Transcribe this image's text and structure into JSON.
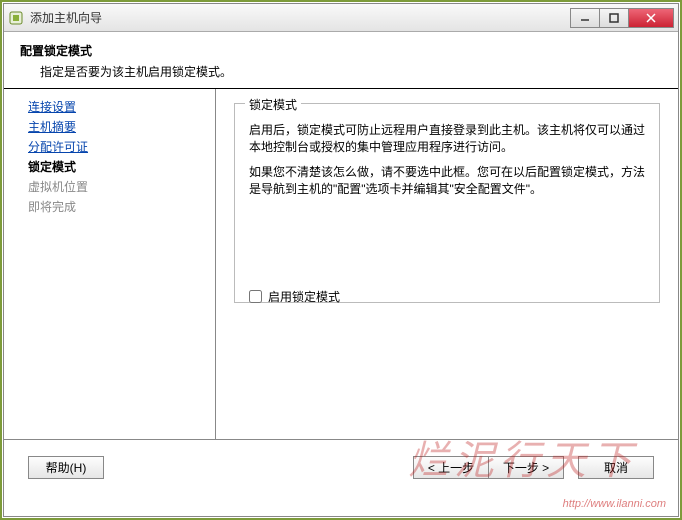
{
  "window": {
    "title": "添加主机向导"
  },
  "header": {
    "title": "配置锁定模式",
    "desc": "指定是否要为该主机启用锁定模式。"
  },
  "sidebar": {
    "items": [
      {
        "label": "连接设置",
        "type": "link"
      },
      {
        "label": "主机摘要",
        "type": "link"
      },
      {
        "label": "分配许可证",
        "type": "link"
      },
      {
        "label": "锁定模式",
        "type": "current"
      },
      {
        "label": "虚拟机位置",
        "type": "disabled"
      },
      {
        "label": "即将完成",
        "type": "disabled"
      }
    ]
  },
  "groupbox": {
    "title": "锁定模式",
    "para1": "启用后，锁定模式可防止远程用户直接登录到此主机。该主机将仅可以通过本地控制台或授权的集中管理应用程序进行访问。",
    "para2": "如果您不清楚该怎么做，请不要选中此框。您可在以后配置锁定模式，方法是导航到主机的\"配置\"选项卡并编辑其\"安全配置文件\"。",
    "checkbox_label": "启用锁定模式"
  },
  "buttons": {
    "help": "帮助(H)",
    "back": "< 上一步",
    "next": "下一步 >",
    "cancel": "取消"
  },
  "watermark": {
    "url": "http://www.ilanni.com",
    "text": "烂泥行天下"
  }
}
